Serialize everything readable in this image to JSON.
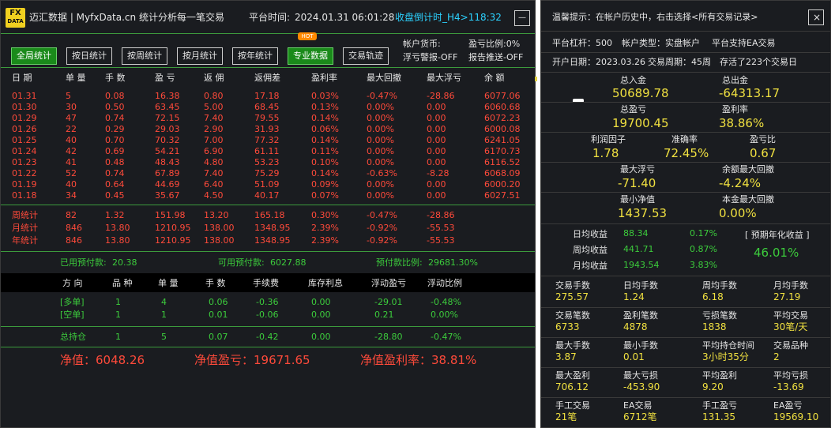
{
  "header": {
    "logo_top": "FX",
    "logo_bottom": "DATA",
    "title": "迈汇数据 | MyfxData.cn",
    "subtitle": "统计分析每一笔交易",
    "time_label": "平台时间:",
    "time_value": "2024.01.31 06:01:28",
    "countdown": "收盘倒计时_H4>118:32",
    "min_icon": "—"
  },
  "tabs": [
    {
      "label": "全局统计",
      "active": true
    },
    {
      "label": "按日统计",
      "active": false
    },
    {
      "label": "按周统计",
      "active": false
    },
    {
      "label": "按月统计",
      "active": false
    },
    {
      "label": "按年统计",
      "active": false
    },
    {
      "label": "专业数据",
      "active": true
    },
    {
      "label": "交易轨迹",
      "active": false
    }
  ],
  "hot_badge": "HOT",
  "account_info": {
    "currency": "帐户货币:",
    "warning": "浮亏警报-OFF",
    "profit_ratio": "盈亏比例:0%",
    "report": "报告推送-OFF"
  },
  "daily_headers": [
    "日 期",
    "单 量",
    "手 数",
    "盈 亏",
    "返 佣",
    "返佣差",
    "盈利率",
    "最大回撤",
    "最大浮亏",
    "余 额"
  ],
  "daily_rows": [
    [
      "01.31",
      "5",
      "0.08",
      "16.38",
      "0.80",
      "17.18",
      "0.03%",
      "-0.47%",
      "-28.86",
      "6077.06"
    ],
    [
      "01.30",
      "30",
      "0.50",
      "63.45",
      "5.00",
      "68.45",
      "0.13%",
      "0.00%",
      "0.00",
      "6060.68"
    ],
    [
      "01.29",
      "47",
      "0.74",
      "72.15",
      "7.40",
      "79.55",
      "0.14%",
      "0.00%",
      "0.00",
      "6072.23"
    ],
    [
      "01.26",
      "22",
      "0.29",
      "29.03",
      "2.90",
      "31.93",
      "0.06%",
      "0.00%",
      "0.00",
      "6000.08"
    ],
    [
      "01.25",
      "40",
      "0.70",
      "70.32",
      "7.00",
      "77.32",
      "0.14%",
      "0.00%",
      "0.00",
      "6241.05"
    ],
    [
      "01.24",
      "42",
      "0.69",
      "54.21",
      "6.90",
      "61.11",
      "0.11%",
      "0.00%",
      "0.00",
      "6170.73"
    ],
    [
      "01.23",
      "41",
      "0.48",
      "48.43",
      "4.80",
      "53.23",
      "0.10%",
      "0.00%",
      "0.00",
      "6116.52"
    ],
    [
      "01.22",
      "52",
      "0.74",
      "67.89",
      "7.40",
      "75.29",
      "0.14%",
      "-0.63%",
      "-8.28",
      "6068.09"
    ],
    [
      "01.19",
      "40",
      "0.64",
      "44.69",
      "6.40",
      "51.09",
      "0.09%",
      "0.00%",
      "0.00",
      "6000.20"
    ],
    [
      "01.18",
      "34",
      "0.45",
      "35.67",
      "4.50",
      "40.17",
      "0.07%",
      "0.00%",
      "0.00",
      "6027.51"
    ]
  ],
  "summary_rows": [
    [
      "周统计",
      "82",
      "1.32",
      "151.98",
      "13.20",
      "165.18",
      "0.30%",
      "-0.47%",
      "-28.86"
    ],
    [
      "月统计",
      "846",
      "13.80",
      "1210.95",
      "138.00",
      "1348.95",
      "2.39%",
      "-0.92%",
      "-55.53"
    ],
    [
      "年统计",
      "846",
      "13.80",
      "1210.95",
      "138.00",
      "1348.95",
      "2.39%",
      "-0.92%",
      "-55.53"
    ]
  ],
  "prepay": {
    "used_label": "已用预付款:",
    "used": "20.38",
    "avail_label": "可用预付款:",
    "avail": "6027.88",
    "ratio_label": "预付款比例:",
    "ratio": "29681.30%"
  },
  "pos_headers": [
    "方 向",
    "品 种",
    "单 量",
    "手 数",
    "手续费",
    "库存利息",
    "浮动盈亏",
    "浮动比例"
  ],
  "pos_rows": [
    [
      "[多单]",
      "1",
      "4",
      "0.06",
      "-0.36",
      "0.00",
      "-29.01",
      "-0.48%"
    ],
    [
      "[空单]",
      "1",
      "1",
      "0.01",
      "-0.06",
      "0.00",
      "0.21",
      "0.00%"
    ]
  ],
  "total_row": [
    "总持仓",
    "1",
    "5",
    "0.07",
    "-0.42",
    "0.00",
    "-28.80",
    "-0.47%"
  ],
  "bottom": {
    "equity": "净值：6048.26",
    "equity_profit": "净值盈亏：19671.65",
    "equity_rate": "净值盈利率：38.81%"
  },
  "right": {
    "tip": "温馨提示：在帐户历史中，右击选择<所有交易记录>",
    "close_icon": "×",
    "leverage": "平台杠杆：500",
    "account_type": "帐户类型：实盘帐户",
    "ea": "平台支持EA交易",
    "open_date": "开户日期：2023.03.26",
    "period": "交易周期：45周",
    "survival": "存活了223个交易日",
    "deposit_label": "总入金",
    "deposit": "50689.78",
    "withdraw_label": "总出金",
    "withdraw": "-64313.17",
    "profit_label": "总盈亏",
    "profit": "19700.45",
    "profit_rate_label": "盈利率",
    "profit_rate": "38.86%",
    "pf_label": "利润因子",
    "pf": "1.78",
    "accuracy_label": "准确率",
    "accuracy": "72.45%",
    "pl_label": "盈亏比",
    "pl": "0.67",
    "maxfloat_label": "最大浮亏",
    "maxfloat": "-71.40",
    "maxdd_label": "余额最大回撤",
    "maxdd": "-4.24%",
    "minnet_label": "最小净值",
    "minnet": "1437.53",
    "principal_dd_label": "本金最大回撤",
    "principal_dd": "0.00%",
    "daily_avg_label": "日均收益",
    "daily_avg": "88.34",
    "daily_avg_pct": "0.17%",
    "weekly_avg_label": "周均收益",
    "weekly_avg": "441.71",
    "weekly_avg_pct": "0.87%",
    "monthly_avg_label": "月均收益",
    "monthly_avg": "1943.54",
    "monthly_avg_pct": "3.83%",
    "annual_label": "[ 预期年化收益 ]",
    "annual": "46.01%",
    "stats": [
      [
        [
          "交易手数",
          "275.57"
        ],
        [
          "日均手数",
          "1.24"
        ],
        [
          "周均手数",
          "6.18"
        ],
        [
          "月均手数",
          "27.19"
        ]
      ],
      [
        [
          "交易笔数",
          "6733"
        ],
        [
          "盈利笔数",
          "4878"
        ],
        [
          "亏损笔数",
          "1838"
        ],
        [
          "平均交易",
          "30笔/天"
        ]
      ],
      [
        [
          "最大手数",
          "3.87"
        ],
        [
          "最小手数",
          "0.01"
        ],
        [
          "平均持仓时间",
          "3小时35分"
        ],
        [
          "交易品种",
          "2"
        ]
      ],
      [
        [
          "最大盈利",
          "706.12"
        ],
        [
          "最大亏损",
          "-453.90"
        ],
        [
          "平均盈利",
          "9.20"
        ],
        [
          "平均亏损",
          "-13.69"
        ]
      ],
      [
        [
          "手工交易",
          "21笔"
        ],
        [
          "EA交易",
          "6712笔"
        ],
        [
          "手工盈亏",
          "131.35"
        ],
        [
          "EA盈亏",
          "19569.10"
        ]
      ]
    ]
  }
}
